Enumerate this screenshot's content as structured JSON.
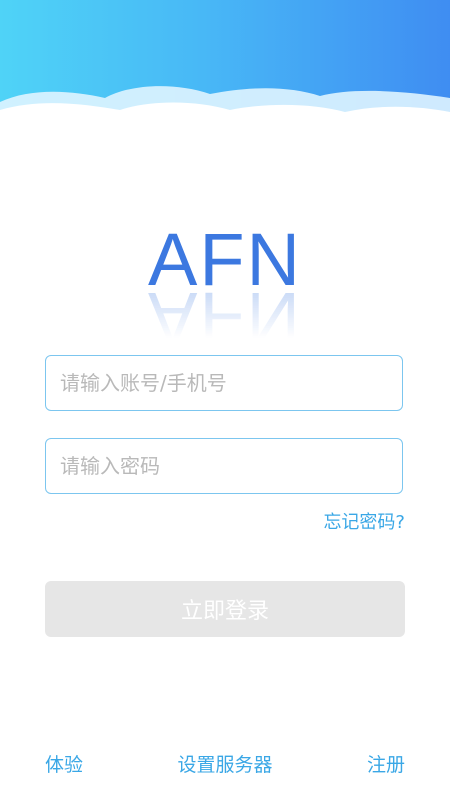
{
  "header": {
    "gradient_start": "#4fd3f7",
    "gradient_end": "#3f8df2"
  },
  "logo": {
    "text": "AFN",
    "color": "#3c78e0"
  },
  "form": {
    "account_placeholder": "请输入账号/手机号",
    "password_placeholder": "请输入密码",
    "forgot_label": "忘记密码?",
    "login_label": "立即登录",
    "accent_color": "#3aa7e6"
  },
  "footer": {
    "trial_label": "体验",
    "server_label": "设置服务器",
    "register_label": "注册"
  }
}
